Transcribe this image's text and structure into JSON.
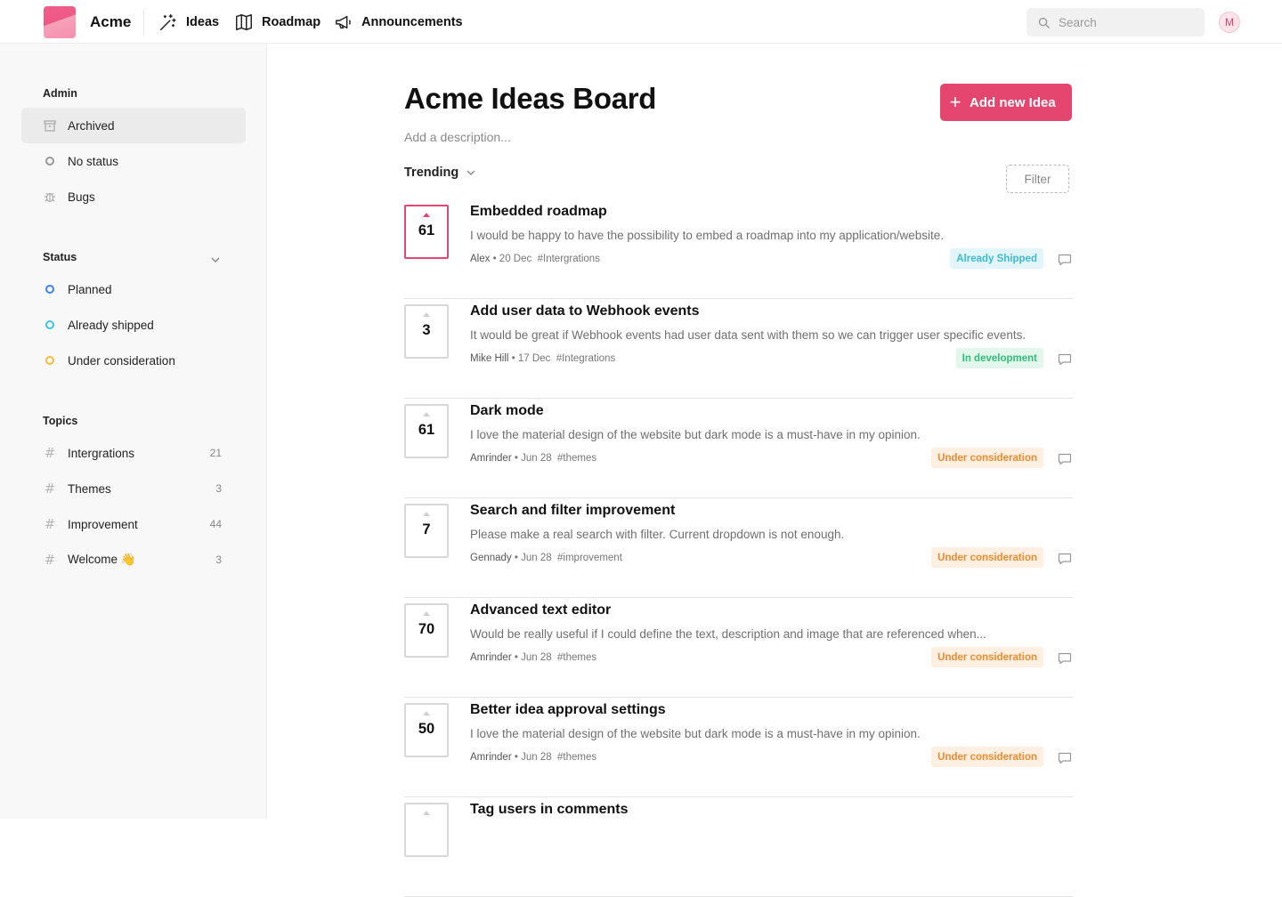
{
  "app": {
    "brand": "Acme"
  },
  "nav": [
    {
      "label": "Ideas",
      "icon": "sparkle-wand-icon"
    },
    {
      "label": "Roadmap",
      "icon": "map-icon"
    },
    {
      "label": "Announcements",
      "icon": "megaphone-icon"
    }
  ],
  "search": {
    "placeholder": "Search"
  },
  "user": {
    "initial": "M"
  },
  "sidebar": {
    "admin_title": "Admin",
    "admin_items": [
      {
        "label": "Archived",
        "icon": "archive-icon",
        "active": true
      },
      {
        "label": "No status",
        "icon": "ring-icon"
      },
      {
        "label": "Bugs",
        "icon": "bug-icon"
      }
    ],
    "status_title": "Status",
    "status_items": [
      {
        "label": "Planned",
        "color": "#3b82f6"
      },
      {
        "label": "Already shipped",
        "color": "#3fc6d8"
      },
      {
        "label": "Under consideration",
        "color": "#f5b942"
      }
    ],
    "topics_title": "Topics",
    "topics": [
      {
        "label": "Intergrations",
        "count": "21"
      },
      {
        "label": "Themes",
        "count": "3"
      },
      {
        "label": "Improvement",
        "count": "44"
      },
      {
        "label": "Welcome 👋",
        "count": "3"
      }
    ]
  },
  "main": {
    "title": "Acme Ideas Board",
    "description": "Add a description...",
    "add_button": "Add new Idea",
    "sort_label": "Trending",
    "filter_label": "Filter",
    "accent": "#e5466f"
  },
  "ideas": [
    {
      "votes": "61",
      "voted": true,
      "title": "Embedded roadmap",
      "desc": "I would be happy to have the possibility to embed a roadmap into my application/website.",
      "author": "Alex",
      "date": "20 Dec",
      "tag": "#Intergrations",
      "status": "Already Shipped",
      "status_color": "#3fb8cf",
      "status_bg": "#e2f6fa"
    },
    {
      "votes": "3",
      "voted": false,
      "title": "Add user data to Webhook events",
      "desc": "It would be great if Webhook events had user data sent with them so we can trigger user specific events.",
      "author": "Mike Hill",
      "date": "17 Dec",
      "tag": "#Integrations",
      "status": "In development",
      "status_color": "#2fbf7a",
      "status_bg": "#e3f7ec"
    },
    {
      "votes": "61",
      "voted": false,
      "title": "Dark mode",
      "desc": "I love the material design of the website but dark mode is a must-have in my opinion.",
      "author": "Amrinder",
      "date": "Jun 28",
      "tag": "#themes",
      "status": "Under consideration",
      "status_color": "#ef8a2d",
      "status_bg": "#fdf0e2"
    },
    {
      "votes": "7",
      "voted": false,
      "title": "Search and filter improvement",
      "desc": "Please make a real search with filter.  Current dropdown is not enough.",
      "author": "Gennady",
      "date": "Jun 28",
      "tag": "#improvement",
      "status": "Under consideration",
      "status_color": "#ef8a2d",
      "status_bg": "#fdf0e2"
    },
    {
      "votes": "70",
      "voted": false,
      "title": "Advanced text editor",
      "desc": "Would be really useful if I could define the text, description and image that are referenced when...",
      "author": "Amrinder",
      "date": "Jun 28",
      "tag": "#themes",
      "status": "Under consideration",
      "status_color": "#ef8a2d",
      "status_bg": "#fdf0e2"
    },
    {
      "votes": "50",
      "voted": false,
      "title": "Better idea approval settings",
      "desc": "I love the material design of the website but dark mode is a must-have in my opinion.",
      "author": "Amrinder",
      "date": "Jun 28",
      "tag": "#themes",
      "status": "Under consideration",
      "status_color": "#ef8a2d",
      "status_bg": "#fdf0e2"
    },
    {
      "votes": "",
      "voted": false,
      "title": "Tag users in comments",
      "desc": "",
      "author": "",
      "date": "",
      "tag": "",
      "status": "",
      "status_color": "#ef8a2d",
      "status_bg": "#fdf0e2"
    }
  ]
}
